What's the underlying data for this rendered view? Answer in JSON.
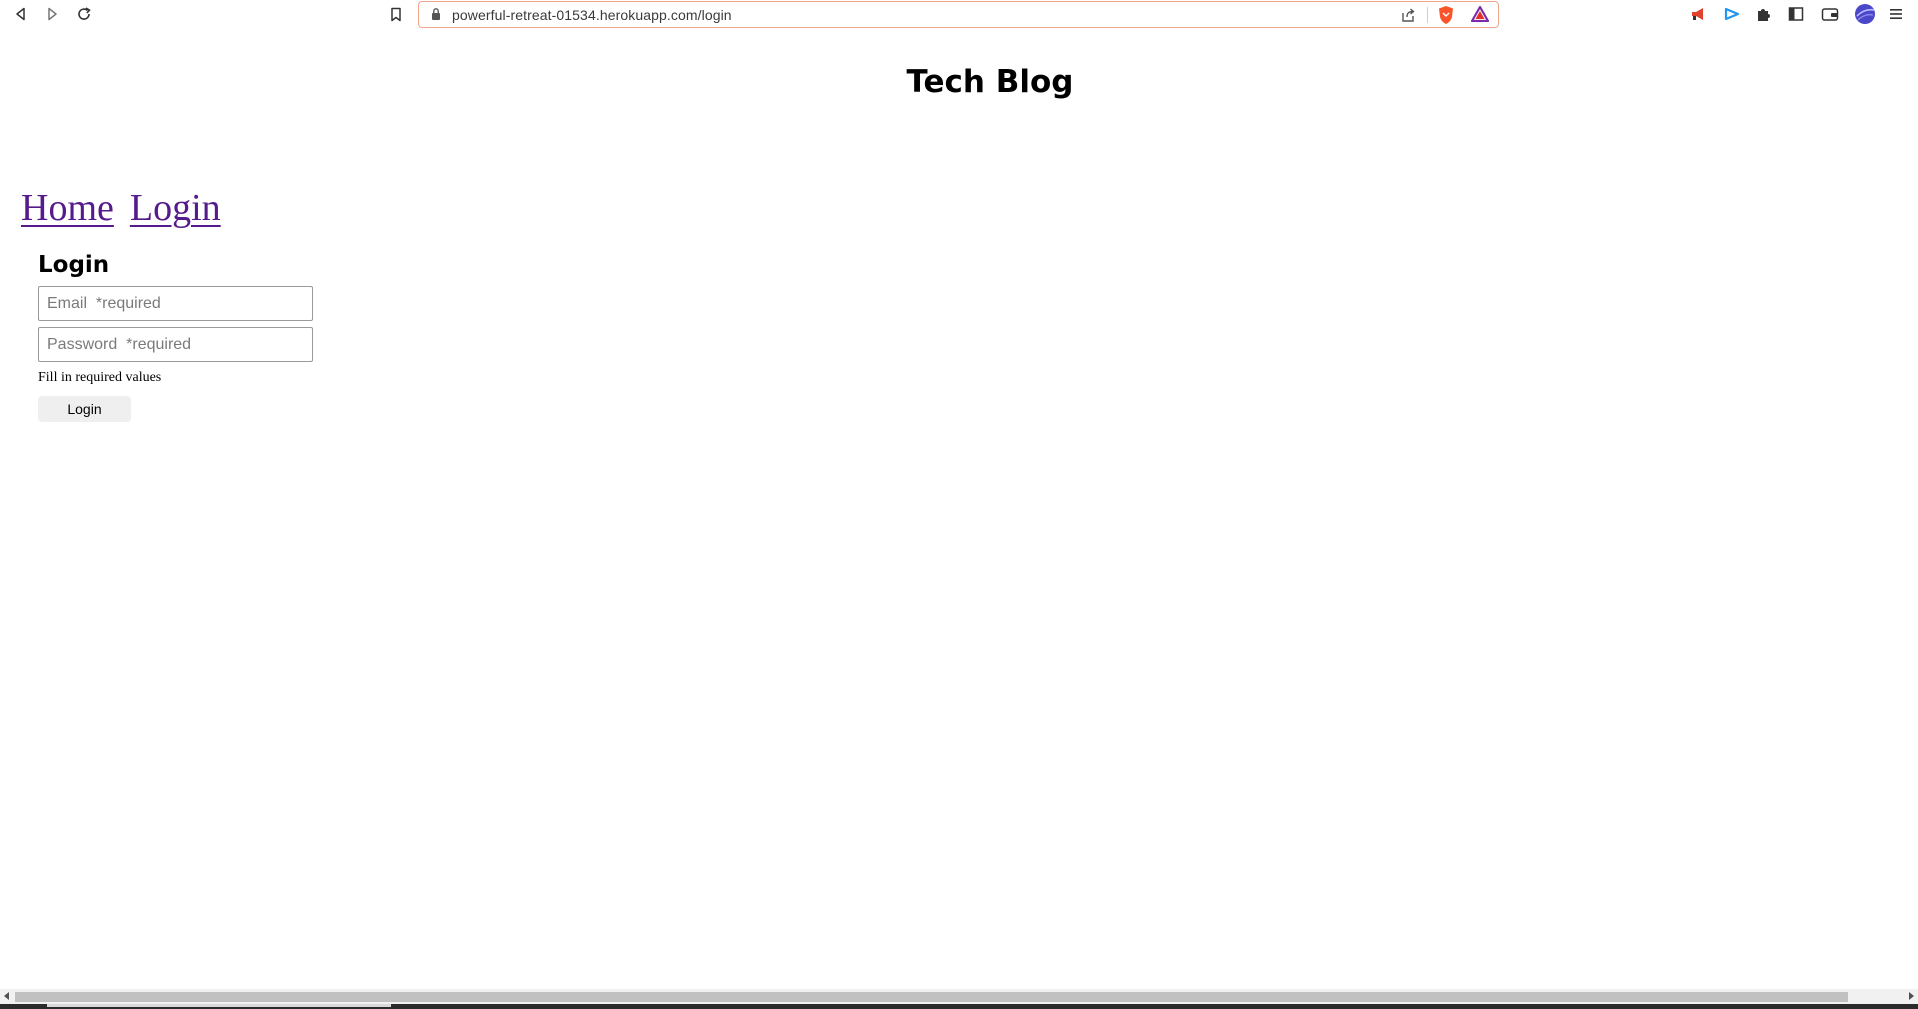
{
  "browser": {
    "url": "powerful-retreat-01534.herokuapp.com/login",
    "icons": {
      "back": "back-arrow-icon",
      "forward": "forward-arrow-icon",
      "reload": "reload-icon",
      "bookmark": "bookmark-icon",
      "lock": "lock-icon",
      "share": "share-icon",
      "brave_shields": "brave-shields-icon",
      "brave_rewards": "brave-rewards-icon",
      "megaphone": "megaphone-extension-icon",
      "extension_blue": "blue-extension-icon",
      "extensions": "puzzle-piece-icon",
      "sidebar": "sidebar-icon",
      "wallet": "wallet-icon",
      "profile": "profile-avatar-icon",
      "menu": "hamburger-menu-icon"
    },
    "colors": {
      "address_border": "#f0a58e",
      "brave_orange": "#fb542b",
      "rewards_purple": "#7b2ca8",
      "profile_blue": "#4b47c9"
    }
  },
  "page": {
    "title": "Tech Blog",
    "nav": [
      {
        "label": "Home"
      },
      {
        "label": "Login"
      }
    ],
    "link_color": "#551a8b",
    "login": {
      "heading": "Login",
      "email_placeholder": "Email  *required",
      "email_value": "",
      "password_placeholder": "Password  *required",
      "password_value": "",
      "message": "Fill in required values",
      "button_label": "Login"
    }
  }
}
